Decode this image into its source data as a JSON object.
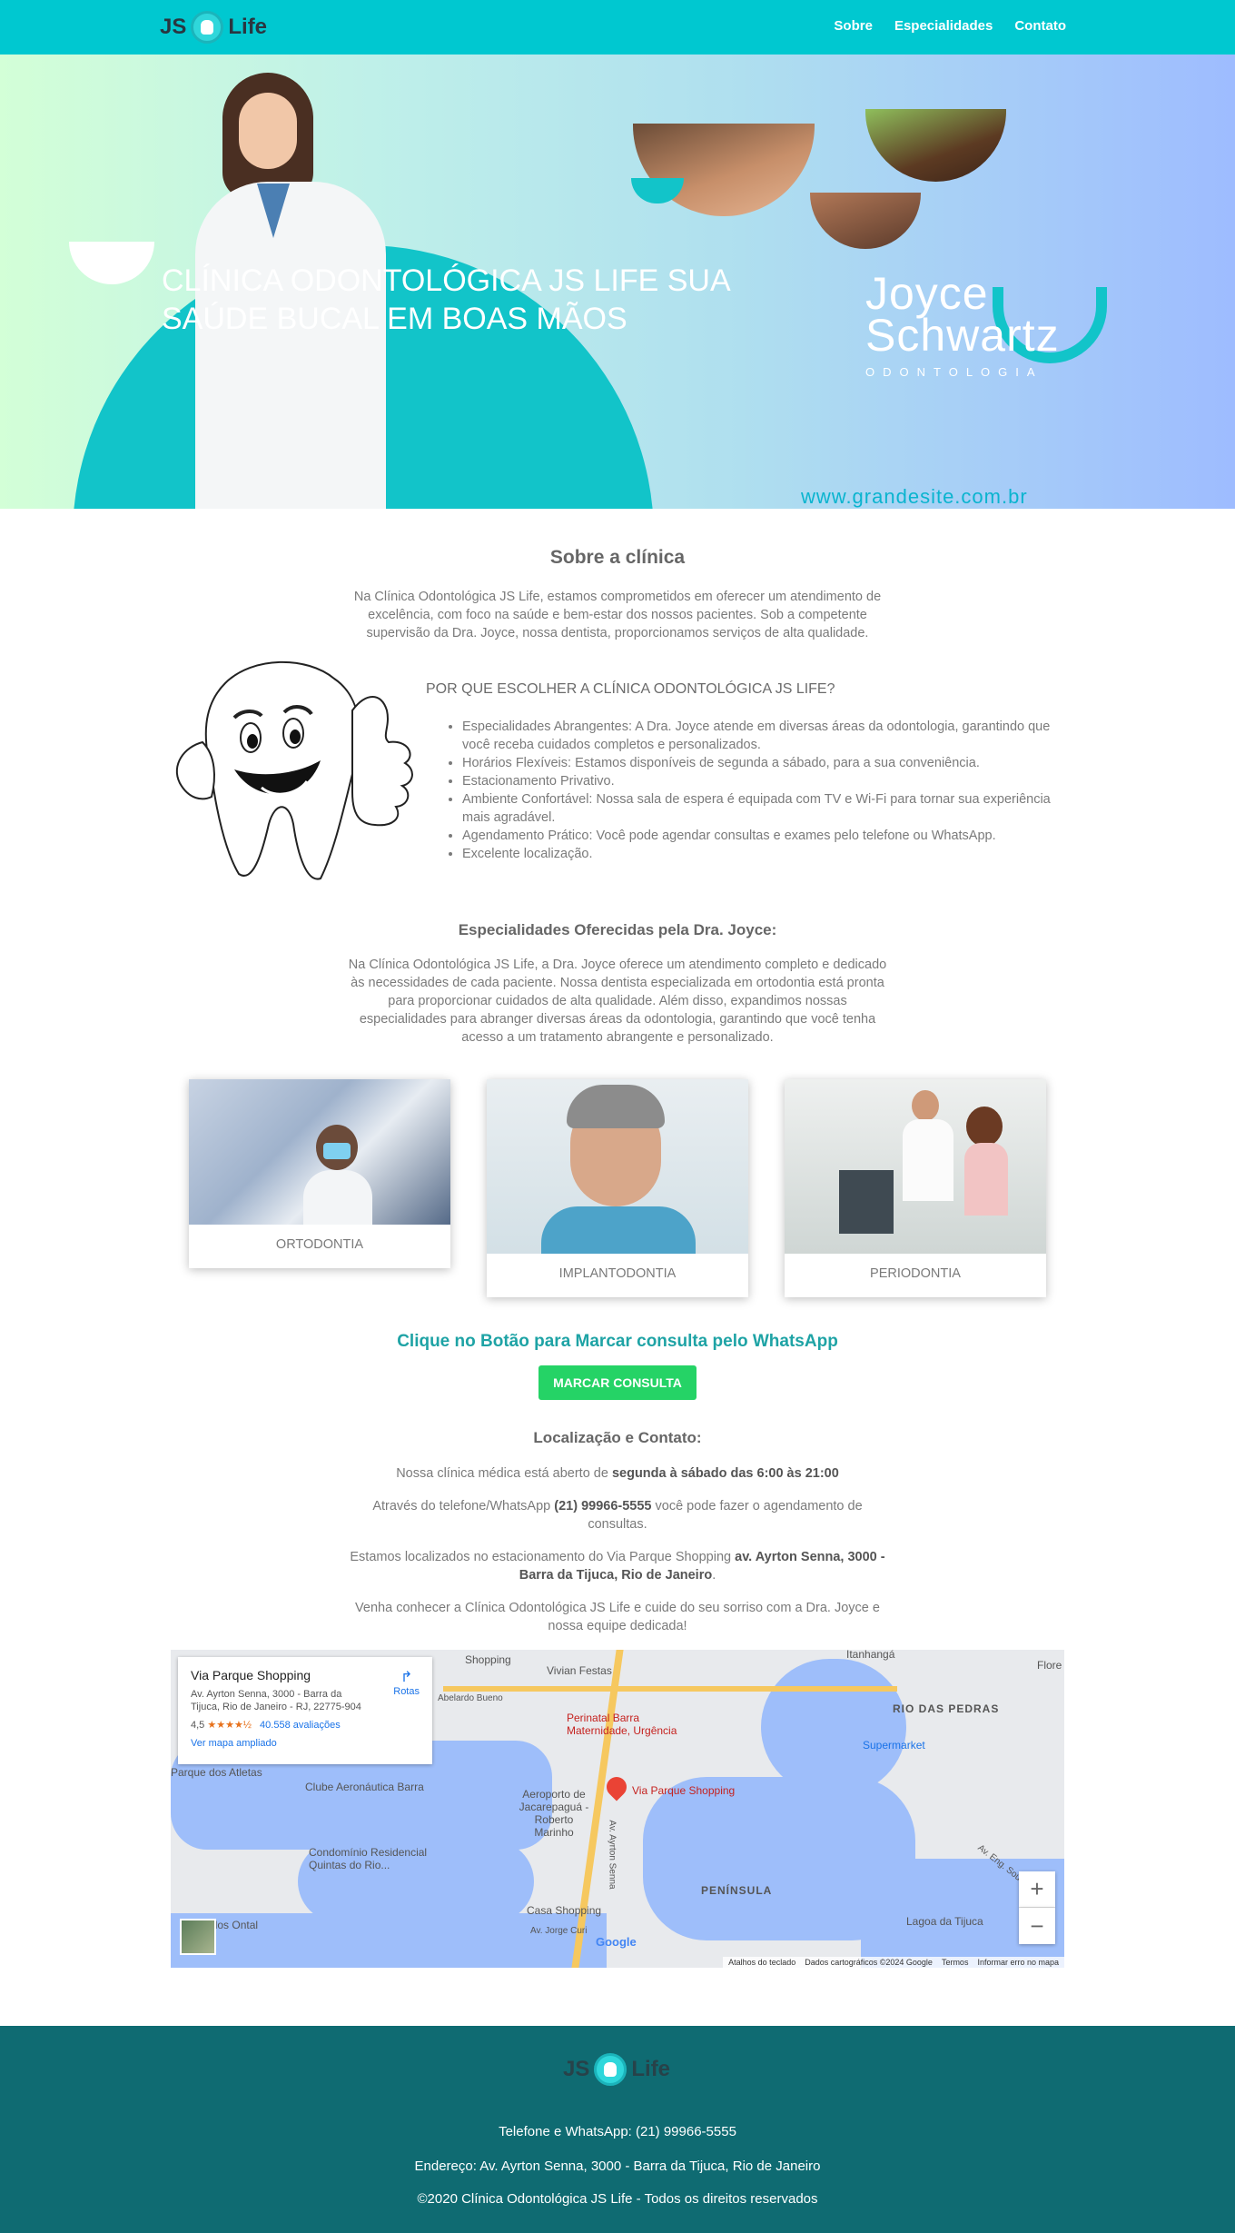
{
  "nav": {
    "logo_left": "JS",
    "logo_right": "Life",
    "links": [
      "Sobre",
      "Especialidades",
      "Contato"
    ]
  },
  "hero": {
    "title": "CLÍNICA ODONTOLÓGICA JS LIFE SUA SAÚDE BUCAL EM BOAS MÃOS",
    "brand_line1": "Joyce",
    "brand_line2": "Schwartz",
    "brand_sub": "ODONTOLOGIA",
    "website": "www.grandesite.com.br"
  },
  "about": {
    "title": "Sobre a clínica",
    "text": "Na Clínica Odontológica JS Life, estamos comprometidos em oferecer um atendimento de excelência, com foco na saúde e bem-estar dos nossos pacientes. Sob a competente supervisão da Dra. Joyce, nossa dentista, proporcionamos serviços de alta qualidade."
  },
  "why": {
    "title": "POR QUE ESCOLHER A CLÍNICA ODONTOLÓGICA JS LIFE?",
    "items": [
      "Especialidades Abrangentes: A Dra. Joyce atende em diversas áreas da odontologia, garantindo que você receba cuidados completos e personalizados.",
      "Horários Flexíveis: Estamos disponíveis de segunda a sábado, para a sua conveniência.",
      "Estacionamento Privativo.",
      "Ambiente Confortável: Nossa sala de espera é equipada com TV e Wi-Fi para tornar sua experiência mais agradável.",
      "Agendamento Prático: Você pode agendar consultas e exames pelo telefone ou WhatsApp.",
      "Excelente localização."
    ]
  },
  "specialties": {
    "title": "Especialidades Oferecidas pela Dra. Joyce:",
    "text": "Na Clínica Odontológica JS Life, a Dra. Joyce oferece um atendimento completo e dedicado às necessidades de cada paciente. Nossa dentista especializada em ortodontia está pronta para proporcionar cuidados de alta qualidade. Além disso, expandimos nossas especialidades para abranger diversas áreas da odontologia, garantindo que você tenha acesso a um tratamento abrangente e personalizado.",
    "cards": [
      "ORTODONTIA",
      "IMPLANTODONTIA",
      "PERIODONTIA"
    ]
  },
  "cta": {
    "title": "Clique no Botão para Marcar consulta pelo WhatsApp",
    "button": "MARCAR CONSULTA"
  },
  "contact": {
    "title": "Localização e Contato:",
    "hours_prefix": "Nossa clínica médica está aberto de ",
    "hours_bold": "segunda à sábado das 6:00 às 21:00",
    "phone_prefix": "Através do telefone/WhatsApp ",
    "phone_bold": "(21) 99966-5555",
    "phone_suffix": " você pode fazer o agendamento de consultas.",
    "address_prefix": "Estamos localizados no estacionamento do Via Parque Shopping ",
    "address_bold": "av. Ayrton Senna, 3000 - Barra da Tijuca, Rio de Janeiro",
    "address_suffix": ".",
    "closing": "Venha conhecer a Clínica Odontológica JS Life e cuide do seu sorriso com a Dra. Joyce e nossa equipe dedicada!"
  },
  "map": {
    "place_name": "Via Parque Shopping",
    "place_address": "Av. Ayrton Senna, 3000 - Barra da Tijuca, Rio de Janeiro - RJ, 22775-904",
    "rating": "4,5",
    "stars": "★★★★½",
    "reviews": "40.558 avaliações",
    "directions": "Rotas",
    "larger_map": "Ver mapa ampliado",
    "zoom_in": "+",
    "zoom_out": "−",
    "labels": [
      "Shopping",
      "Vivian Festas",
      "Itanhangá",
      "Flore",
      "Abelardo Bueno",
      "RIO DAS PEDRAS",
      "Perinatal Barra Maternidade, Urgência",
      "Supermarket",
      "Parque dos Atletas",
      "Clube Aeronáutica Barra",
      "Aeroporto de Jacarepaguá - Roberto Marinho",
      "Via Parque Shopping",
      "Condomínio Residencial Quintas do Rio...",
      "Av. Ayrton Senna",
      "PENÍNSULA",
      "Lagoa da Tijuca",
      "Casa Shopping",
      "Av. Jorge Curi",
      "Av. Eng. Souza Filho",
      "Ponte dos Ontal",
      "Google"
    ],
    "attrib": [
      "Atalhos do teclado",
      "Dados cartográficos ©2024 Google",
      "Termos",
      "Informar erro no mapa"
    ]
  },
  "footer": {
    "logo_left": "JS",
    "logo_right": "Life",
    "phone": "Telefone e WhatsApp: (21) 99966-5555",
    "address": "Endereço: Av. Ayrton Senna, 3000 - Barra da Tijuca, Rio de Janeiro",
    "copyright": "©2020 Clínica Odontológica JS Life - Todos os direitos reservados"
  },
  "colors": {
    "nav": "#00c8d0",
    "cta_button": "#25d366",
    "footer": "#0f6b72",
    "cta_title": "#1ea3a5"
  }
}
